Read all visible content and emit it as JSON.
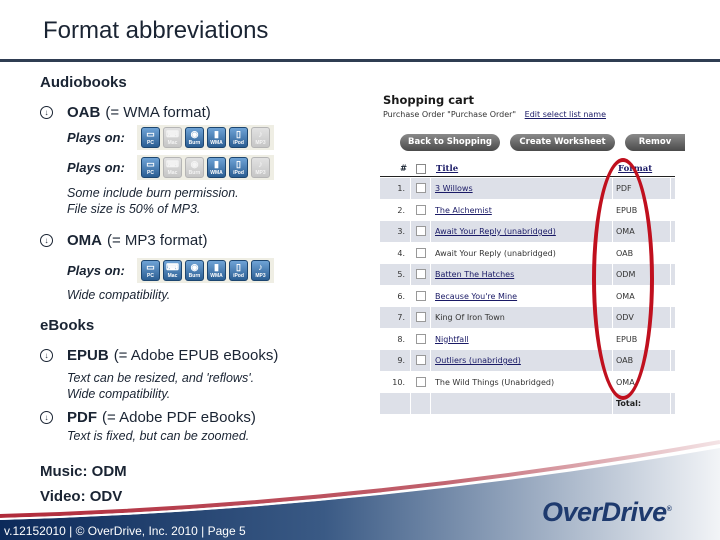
{
  "title": "Format abbreviations",
  "audiobooks": {
    "heading": "Audiobooks",
    "oab": {
      "code": "OAB",
      "desc": "(= WMA format)",
      "plays_on_label": "Plays on:",
      "devices_row1": [
        {
          "label": "PC",
          "icon": "computer-icon",
          "enabled": true
        },
        {
          "label": "Mac",
          "icon": "laptop-icon",
          "enabled": false
        },
        {
          "label": "Burn to CD",
          "icon": "burn-cd-icon",
          "enabled": true
        },
        {
          "label": "WMA",
          "icon": "wma-player-icon",
          "enabled": true
        },
        {
          "label": "iPod",
          "icon": "ipod-icon",
          "enabled": true
        },
        {
          "label": "MP3",
          "icon": "mp3-player-icon",
          "enabled": false
        }
      ],
      "devices_row2": [
        {
          "label": "PC",
          "icon": "computer-icon",
          "enabled": true
        },
        {
          "label": "Mac",
          "icon": "laptop-icon",
          "enabled": false
        },
        {
          "label": "Burn to CD",
          "icon": "burn-cd-icon",
          "enabled": false
        },
        {
          "label": "WMA",
          "icon": "wma-player-icon",
          "enabled": true
        },
        {
          "label": "iPod",
          "icon": "ipod-icon",
          "enabled": true
        },
        {
          "label": "MP3",
          "icon": "mp3-player-icon",
          "enabled": false
        }
      ],
      "note_line1": "Some include burn permission.",
      "note_line2": "File size is 50% of MP3."
    },
    "oma": {
      "code": "OMA",
      "desc": "(= MP3 format)",
      "plays_on_label": "Plays on:",
      "devices": [
        {
          "label": "PC",
          "icon": "computer-icon",
          "enabled": true
        },
        {
          "label": "Mac",
          "icon": "laptop-icon",
          "enabled": true
        },
        {
          "label": "Burn to CD",
          "icon": "burn-cd-icon",
          "enabled": true
        },
        {
          "label": "WMA",
          "icon": "wma-player-icon",
          "enabled": true
        },
        {
          "label": "iPod",
          "icon": "ipod-icon",
          "enabled": true
        },
        {
          "label": "MP3",
          "icon": "mp3-player-icon",
          "enabled": true
        }
      ],
      "note": "Wide compatibility."
    }
  },
  "ebooks": {
    "heading": "eBooks",
    "epub": {
      "code": "EPUB",
      "desc": "(= Adobe EPUB eBooks)",
      "note_line1": "Text can be resized, and 'reflows'.",
      "note_line2": "Wide compatibility."
    },
    "pdf": {
      "code": "PDF",
      "desc": "(= Adobe PDF eBooks)",
      "note": "Text is fixed, but can be zoomed."
    }
  },
  "music": "Music:  ODM",
  "video": "Video:  ODV",
  "cart": {
    "title": "Shopping cart",
    "subtitle": "Purchase Order \"Purchase Order\"",
    "edit_link": "Edit select list name",
    "buttons": {
      "back": "Back to Shopping",
      "worksheet": "Create Worksheet",
      "remove": "Remov"
    },
    "headers": {
      "num": "#",
      "title": "Title",
      "format": "Format"
    },
    "rows": [
      {
        "num": "1.",
        "title": "3 Willows",
        "format": "PDF",
        "link": true
      },
      {
        "num": "2.",
        "title": "The Alchemist",
        "format": "EPUB",
        "link": true
      },
      {
        "num": "3.",
        "title": "Await Your Reply (unabridged)",
        "format": "OMA",
        "link": true
      },
      {
        "num": "4.",
        "title": "Await Your Reply (unabridged)",
        "format": "OAB",
        "link": false
      },
      {
        "num": "5.",
        "title": "Batten The Hatches",
        "format": "ODM",
        "link": true
      },
      {
        "num": "6.",
        "title": "Because You're Mine",
        "format": "OMA",
        "link": true
      },
      {
        "num": "7.",
        "title": "King Of Iron Town",
        "format": "ODV",
        "link": false
      },
      {
        "num": "8.",
        "title": "Nightfall",
        "format": "EPUB",
        "link": true
      },
      {
        "num": "9.",
        "title": "Outliers (unabridged)",
        "format": "OAB",
        "link": true
      },
      {
        "num": "10.",
        "title": "The Wild Things (Unabridged)",
        "format": "OMA",
        "link": false
      }
    ],
    "total_label": "Total:"
  },
  "footer": {
    "text": "v.12152010 | © OverDrive, Inc. 2010 | Page 5",
    "logo": "OverDrive",
    "colors": {
      "navy": "#0c2a5a",
      "red": "#b02a3a"
    }
  }
}
